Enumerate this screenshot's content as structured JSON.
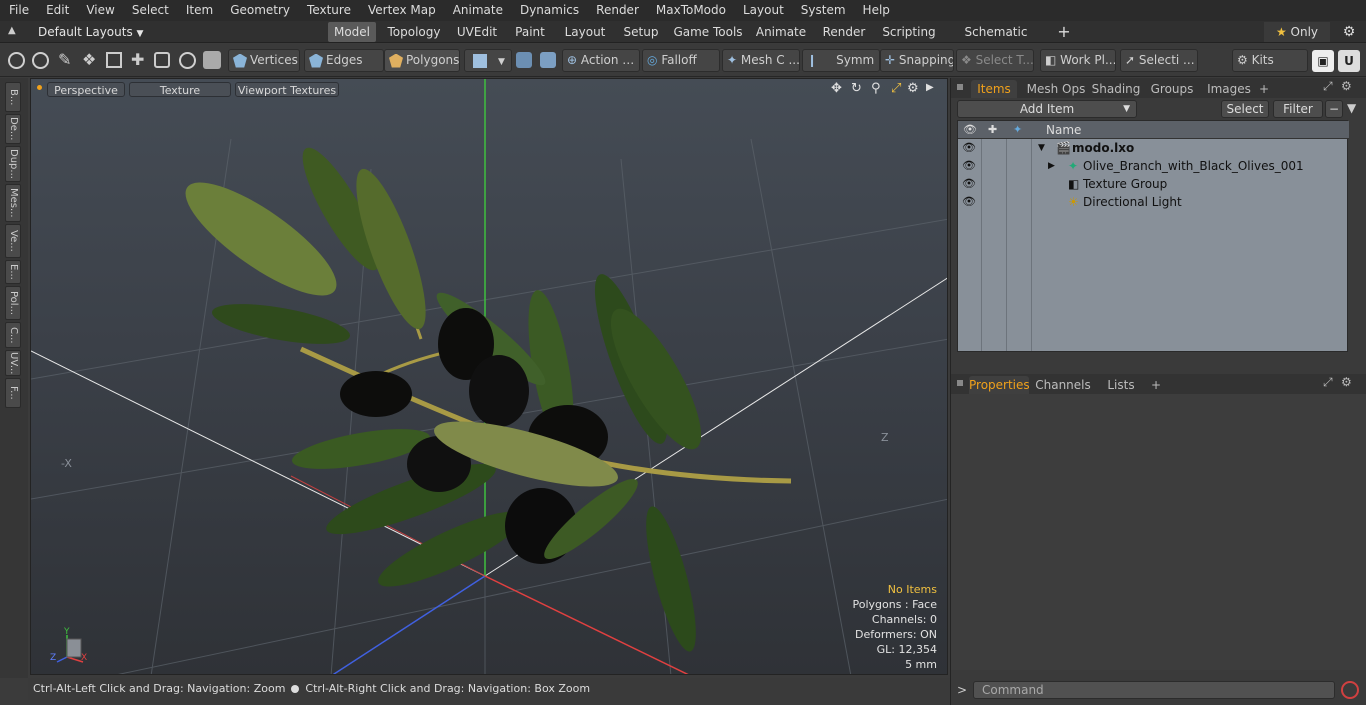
{
  "menu": [
    "File",
    "Edit",
    "View",
    "Select",
    "Item",
    "Geometry",
    "Texture",
    "Vertex Map",
    "Animate",
    "Dynamics",
    "Render",
    "MaxToModo",
    "Layout",
    "System",
    "Help"
  ],
  "layouts": {
    "current": "Default Layouts",
    "tabs": [
      "Model",
      "Topology",
      "UVEdit",
      "Paint",
      "Layout",
      "Setup",
      "Game Tools",
      "Animate",
      "Render",
      "Scripting",
      "Schematic Fusion"
    ],
    "add": "+",
    "only": "Only"
  },
  "toolbar": {
    "vertices": "Vertices",
    "edges": "Edges",
    "polygons": "Polygons",
    "action": "Action",
    "falloff": "Falloff",
    "meshc": "Mesh C ...",
    "symm": "Symm ...",
    "snapping": "Snapping",
    "selectt": "Select T...",
    "workpl": "Work Pl...",
    "selecti": "Selecti ...",
    "kits": "Kits"
  },
  "lefttabs": [
    "B...",
    "De...",
    "Dup...",
    "Mes...",
    "Ve...",
    "E...",
    "Pol...",
    "C...",
    "UV...",
    "F..."
  ],
  "viewport": {
    "perspective": "Perspective",
    "texture": "Texture",
    "viewport_textures": "Viewport Textures",
    "axis_x": "-X",
    "axis_z": "Z",
    "hud": {
      "no_items": "No Items",
      "polygons": "Polygons : Face",
      "channels": "Channels: 0",
      "deformers": "Deformers: ON",
      "gl": "GL: 12,354",
      "scale": "5 mm"
    },
    "gizmo": {
      "y": "Y",
      "z": "Z",
      "x": "X"
    }
  },
  "statusbar": {
    "left": "Ctrl-Alt-Left Click and Drag: Navigation: Zoom",
    "right": "Ctrl-Alt-Right Click and Drag: Navigation: Box Zoom"
  },
  "items_panel": {
    "tabs": [
      "Items",
      "Mesh Ops",
      "Shading",
      "Groups",
      "Images"
    ],
    "add_tab": "+",
    "add_item": "Add Item",
    "select": "Select",
    "filter": "Filter",
    "name_header": "Name",
    "tree": [
      {
        "label": "modo.lxo",
        "indent": 0
      },
      {
        "label": "Olive_Branch_with_Black_Olives_001",
        "indent": 1
      },
      {
        "label": "Texture Group",
        "indent": 1
      },
      {
        "label": "Directional Light",
        "indent": 1
      }
    ]
  },
  "properties_panel": {
    "tabs": [
      "Properties",
      "Channels",
      "Lists"
    ],
    "add_tab": "+"
  },
  "command": {
    "placeholder": "Command",
    "prompt": ">"
  },
  "colors": {
    "accent": "#f0a11b",
    "hud_highlight": "#f0c040",
    "tree_bg": "#889099"
  }
}
